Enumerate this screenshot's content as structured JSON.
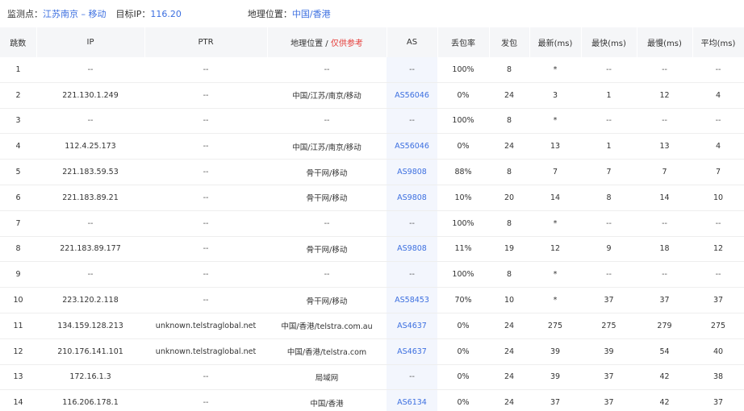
{
  "header": {
    "monitor_label": "监测点：",
    "monitor_value": "江苏南京 – 移动",
    "target_label": "目标IP：",
    "target_value": "116.20",
    "geo_label": "地理位置：",
    "geo_value": "中国/香港"
  },
  "table": {
    "columns": {
      "hop": "跳数",
      "ip": "IP",
      "ptr": "PTR",
      "geo": "地理位置 / ",
      "geo_note": "仅供参考",
      "as": "AS",
      "loss": "丢包率",
      "sent": "发包",
      "latest": "最新(ms)",
      "fastest": "最快(ms)",
      "slowest": "最慢(ms)",
      "avg": "平均(ms)"
    },
    "rows": [
      {
        "hop": "1",
        "ip": "--",
        "ptr": "--",
        "geo": "--",
        "as": "--",
        "loss": "100%",
        "sent": "8",
        "latest": "*",
        "fastest": "--",
        "slowest": "--",
        "avg": "--"
      },
      {
        "hop": "2",
        "ip": "221.130.1.249",
        "ptr": "--",
        "geo": "中国/江苏/南京/移动",
        "as": "AS56046",
        "loss": "0%",
        "sent": "24",
        "latest": "3",
        "fastest": "1",
        "slowest": "12",
        "avg": "4"
      },
      {
        "hop": "3",
        "ip": "--",
        "ptr": "--",
        "geo": "--",
        "as": "--",
        "loss": "100%",
        "sent": "8",
        "latest": "*",
        "fastest": "--",
        "slowest": "--",
        "avg": "--"
      },
      {
        "hop": "4",
        "ip": "112.4.25.173",
        "ptr": "--",
        "geo": "中国/江苏/南京/移动",
        "as": "AS56046",
        "loss": "0%",
        "sent": "24",
        "latest": "13",
        "fastest": "1",
        "slowest": "13",
        "avg": "4"
      },
      {
        "hop": "5",
        "ip": "221.183.59.53",
        "ptr": "--",
        "geo": "骨干网/移动",
        "as": "AS9808",
        "loss": "88%",
        "sent": "8",
        "latest": "7",
        "fastest": "7",
        "slowest": "7",
        "avg": "7"
      },
      {
        "hop": "6",
        "ip": "221.183.89.21",
        "ptr": "--",
        "geo": "骨干网/移动",
        "as": "AS9808",
        "loss": "10%",
        "sent": "20",
        "latest": "14",
        "fastest": "8",
        "slowest": "14",
        "avg": "10"
      },
      {
        "hop": "7",
        "ip": "--",
        "ptr": "--",
        "geo": "--",
        "as": "--",
        "loss": "100%",
        "sent": "8",
        "latest": "*",
        "fastest": "--",
        "slowest": "--",
        "avg": "--"
      },
      {
        "hop": "8",
        "ip": "221.183.89.177",
        "ptr": "--",
        "geo": "骨干网/移动",
        "as": "AS9808",
        "loss": "11%",
        "sent": "19",
        "latest": "12",
        "fastest": "9",
        "slowest": "18",
        "avg": "12"
      },
      {
        "hop": "9",
        "ip": "--",
        "ptr": "--",
        "geo": "--",
        "as": "--",
        "loss": "100%",
        "sent": "8",
        "latest": "*",
        "fastest": "--",
        "slowest": "--",
        "avg": "--"
      },
      {
        "hop": "10",
        "ip": "223.120.2.118",
        "ptr": "--",
        "geo": "骨干网/移动",
        "as": "AS58453",
        "loss": "70%",
        "sent": "10",
        "latest": "*",
        "fastest": "37",
        "slowest": "37",
        "avg": "37"
      },
      {
        "hop": "11",
        "ip": "134.159.128.213",
        "ptr": "unknown.telstraglobal.net",
        "geo": "中国/香港/telstra.com.au",
        "as": "AS4637",
        "loss": "0%",
        "sent": "24",
        "latest": "275",
        "fastest": "275",
        "slowest": "279",
        "avg": "275"
      },
      {
        "hop": "12",
        "ip": "210.176.141.101",
        "ptr": "unknown.telstraglobal.net",
        "geo": "中国/香港/telstra.com",
        "as": "AS4637",
        "loss": "0%",
        "sent": "24",
        "latest": "39",
        "fastest": "39",
        "slowest": "54",
        "avg": "40"
      },
      {
        "hop": "13",
        "ip": "172.16.1.3",
        "ptr": "--",
        "geo": "局域网",
        "as": "--",
        "loss": "0%",
        "sent": "24",
        "latest": "39",
        "fastest": "37",
        "slowest": "42",
        "avg": "38"
      },
      {
        "hop": "14",
        "ip": "116.206.178.1",
        "ptr": "--",
        "geo": "中国/香港",
        "as": "AS6134",
        "loss": "0%",
        "sent": "24",
        "latest": "37",
        "fastest": "37",
        "slowest": "42",
        "avg": "37"
      }
    ]
  }
}
